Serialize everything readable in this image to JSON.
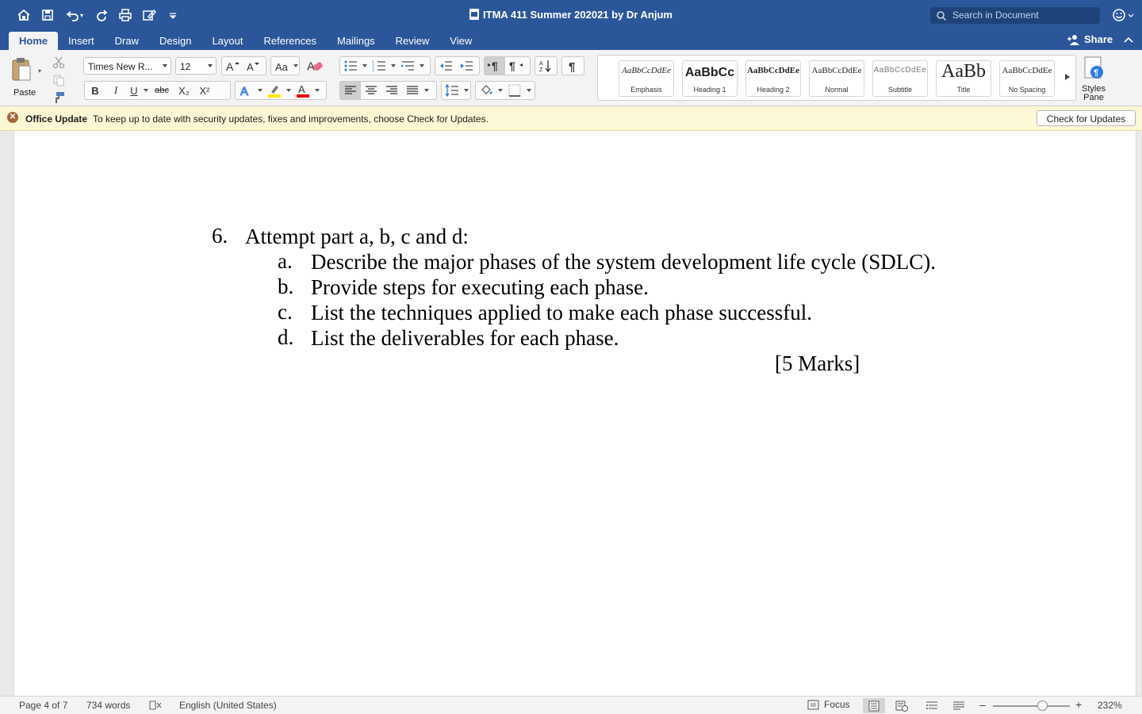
{
  "window": {
    "title": "ITMA 411 Summer 202021 by Dr Anjum"
  },
  "search": {
    "placeholder": "Search in Document"
  },
  "tabs": [
    "Home",
    "Insert",
    "Draw",
    "Design",
    "Layout",
    "References",
    "Mailings",
    "Review",
    "View"
  ],
  "share_label": "Share",
  "ribbon": {
    "paste_label": "Paste",
    "font_name": "Times New R...",
    "font_size": "12",
    "bold": "B",
    "italic": "I",
    "underline": "U",
    "strike": "abc",
    "subscript": "X₂",
    "superscript": "X²",
    "styles": [
      {
        "sample": "AaBbCcDdEe",
        "name": "Emphasis"
      },
      {
        "sample": "AaBbCc",
        "name": "Heading 1"
      },
      {
        "sample": "AaBbCcDdEe",
        "name": "Heading 2"
      },
      {
        "sample": "AaBbCcDdEe",
        "name": "Normal"
      },
      {
        "sample": "AaBbCcDdEe",
        "name": "Subtitle"
      },
      {
        "sample": "AaBb",
        "name": "Title"
      },
      {
        "sample": "AaBbCcDdEe",
        "name": "No Spacing"
      }
    ],
    "styles_pane_label1": "Styles",
    "styles_pane_label2": "Pane"
  },
  "update_bar": {
    "title": "Office Update",
    "message": "To keep up to date with security updates, fixes and improvements, choose Check for Updates.",
    "button": "Check for Updates"
  },
  "document": {
    "question_number": "6.",
    "question": "Attempt part a, b, c and d:",
    "parts": [
      {
        "letter": "a.",
        "text": "Describe the major phases of the system development life cycle (SDLC)."
      },
      {
        "letter": "b.",
        "text": "Provide steps for executing each phase."
      },
      {
        "letter": "c.",
        "text": "List the techniques applied to make each phase successful."
      },
      {
        "letter": "d.",
        "text": "List the deliverables for each phase."
      }
    ],
    "marks": "[5 Marks]"
  },
  "status": {
    "page": "Page 4 of 7",
    "words": "734 words",
    "language": "English (United States)",
    "focus": "Focus",
    "zoom": "232%",
    "zoom_minus": "–",
    "zoom_plus": "+"
  },
  "colors": {
    "brand": "#2b579a",
    "ribbon": "#f3f3f3",
    "update_bar": "#fcf7d5",
    "highlight": "#ffe600",
    "font_color": "#e00000"
  }
}
